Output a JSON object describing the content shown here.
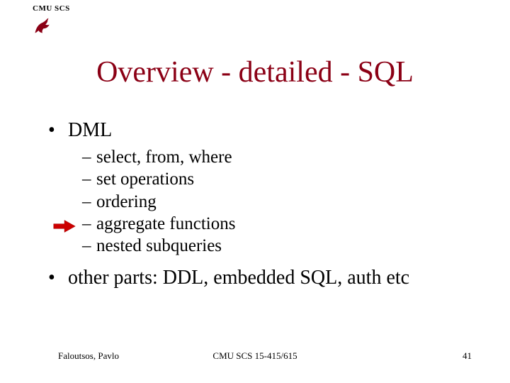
{
  "header": {
    "org": "CMU SCS"
  },
  "title": "Overview - detailed - SQL",
  "bullets": {
    "l1_a": "DML",
    "sub": {
      "a": "select, from, where",
      "b": "set operations",
      "c": "ordering",
      "d": "aggregate functions",
      "e": "nested subqueries"
    },
    "l1_b": "other parts: DDL, embedded SQL, auth etc"
  },
  "footer": {
    "left": "Faloutsos, Pavlo",
    "center": "CMU SCS 15-415/615",
    "right": "41"
  },
  "colors": {
    "title": "#8b0015",
    "arrow": "#cc0000"
  }
}
